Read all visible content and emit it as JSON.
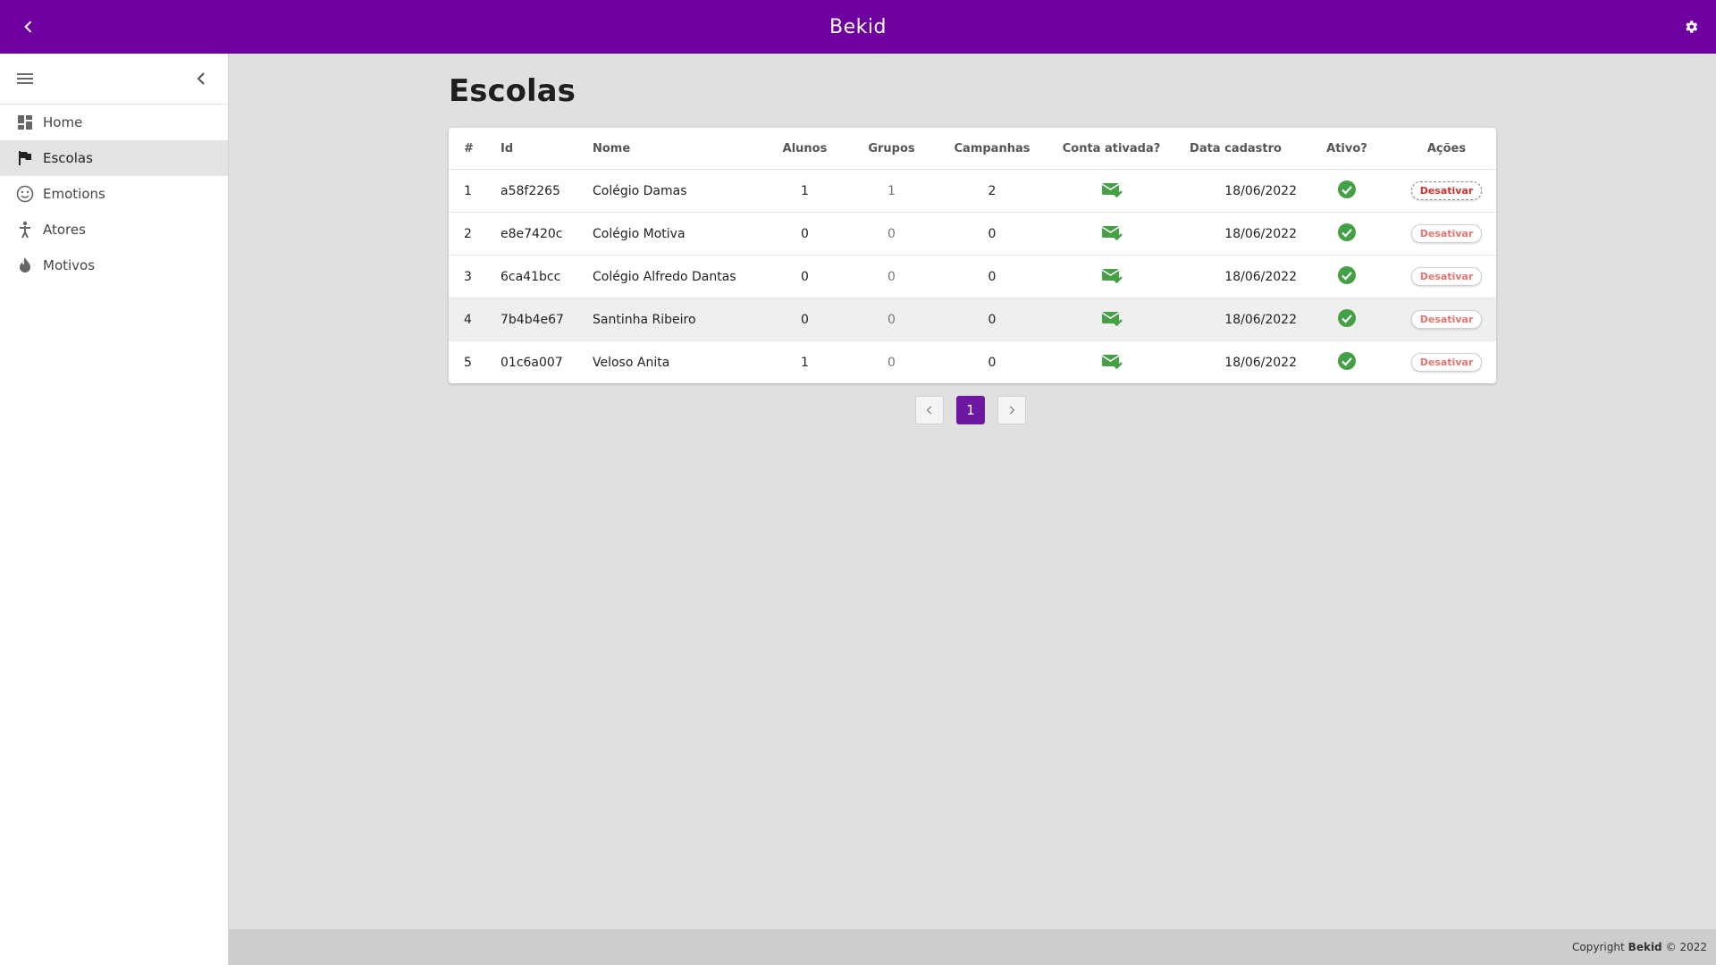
{
  "app": {
    "title": "Bekid"
  },
  "sidebar": {
    "items": [
      {
        "label": "Home",
        "icon": "dashboard-icon",
        "active": false
      },
      {
        "label": "Escolas",
        "icon": "flag-icon",
        "active": true
      },
      {
        "label": "Emotions",
        "icon": "smiley-icon",
        "active": false
      },
      {
        "label": "Atores",
        "icon": "person-icon",
        "active": false
      },
      {
        "label": "Motivos",
        "icon": "flame-icon",
        "active": false
      }
    ]
  },
  "page": {
    "title": "Escolas"
  },
  "table": {
    "headers": [
      "#",
      "Id",
      "Nome",
      "Alunos",
      "Grupos",
      "Campanhas",
      "Conta ativada?",
      "Data cadastro",
      "Ativo?",
      "Ações"
    ],
    "rows": [
      {
        "n": "1",
        "id": "a58f2265",
        "nome": "Colégio Damas",
        "alunos": "1",
        "grupos": "1",
        "campanhas": "2",
        "conta_ativada": "mail-check-icon",
        "data": "18/06/2022",
        "ativo": "check-circle-icon",
        "acao": "Desativar"
      },
      {
        "n": "2",
        "id": "e8e7420c",
        "nome": "Colégio Motiva",
        "alunos": "0",
        "grupos": "0",
        "campanhas": "0",
        "conta_ativada": "mail-check-icon",
        "data": "18/06/2022",
        "ativo": "check-circle-icon",
        "acao": "Desativar"
      },
      {
        "n": "3",
        "id": "6ca41bcc",
        "nome": "Colégio Alfredo Dantas",
        "alunos": "0",
        "grupos": "0",
        "campanhas": "0",
        "conta_ativada": "mail-check-icon",
        "data": "18/06/2022",
        "ativo": "check-circle-icon",
        "acao": "Desativar"
      },
      {
        "n": "4",
        "id": "7b4b4e67",
        "nome": "Santinha Ribeiro",
        "alunos": "0",
        "grupos": "0",
        "campanhas": "0",
        "conta_ativada": "mail-check-icon",
        "data": "18/06/2022",
        "ativo": "check-circle-icon",
        "acao": "Desativar"
      },
      {
        "n": "5",
        "id": "01c6a007",
        "nome": "Veloso Anita",
        "alunos": "1",
        "grupos": "0",
        "campanhas": "0",
        "conta_ativada": "mail-check-icon",
        "data": "18/06/2022",
        "ativo": "check-circle-icon",
        "acao": "Desativar"
      }
    ]
  },
  "pagination": {
    "current_page": "1",
    "prev_icon": "chevron-left-icon",
    "next_icon": "chevron-right-icon"
  },
  "footer": {
    "prefix": "Copyright",
    "brand": "Bekid",
    "suffix": "© 2022"
  },
  "colors": {
    "brand": "#6e00a0",
    "success": "#43a047",
    "danger": "#e57373"
  }
}
